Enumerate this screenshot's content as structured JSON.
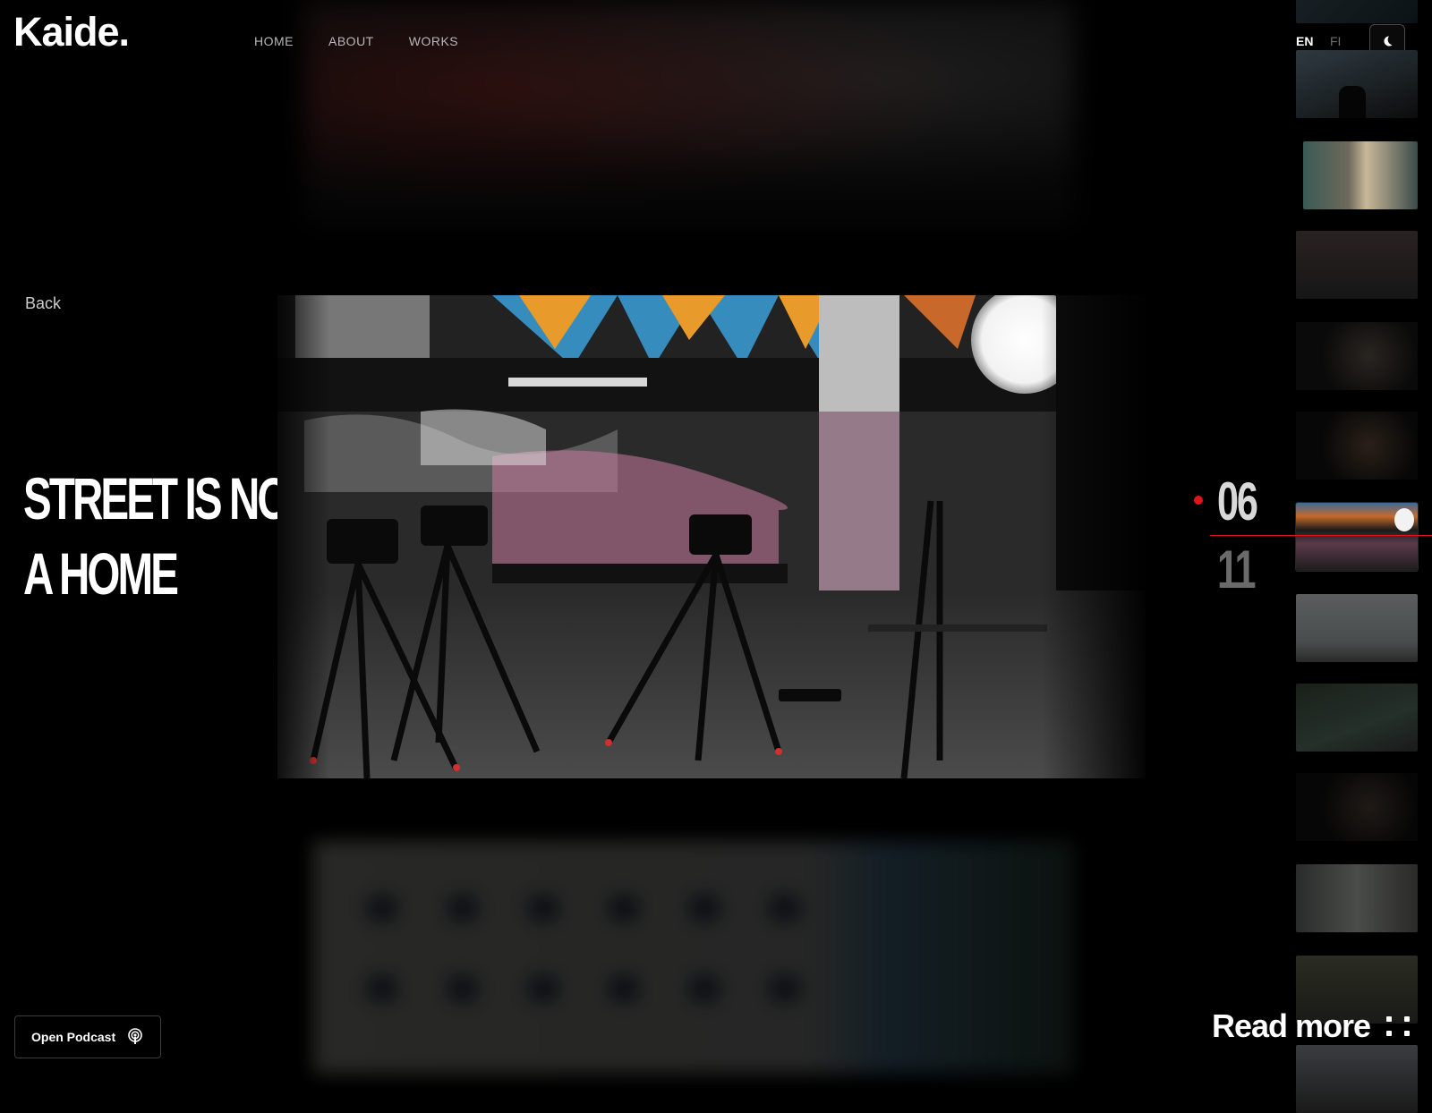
{
  "header": {
    "logo": "Kaide.",
    "nav": [
      "HOME",
      "ABOUT",
      "WORKS"
    ],
    "lang_active": "EN",
    "lang_other": "FI",
    "theme_icon": "moon-icon"
  },
  "project": {
    "back_label": "Back",
    "title_line1": "STREET IS NOT",
    "title_line2": "A HOME"
  },
  "counter": {
    "current": "06",
    "total": "11"
  },
  "footer": {
    "podcast_label": "Open Podcast",
    "podcast_icon": "podcast-icon",
    "read_more": "Read more"
  },
  "colors": {
    "accent": "#e0141a",
    "background": "#000000"
  }
}
